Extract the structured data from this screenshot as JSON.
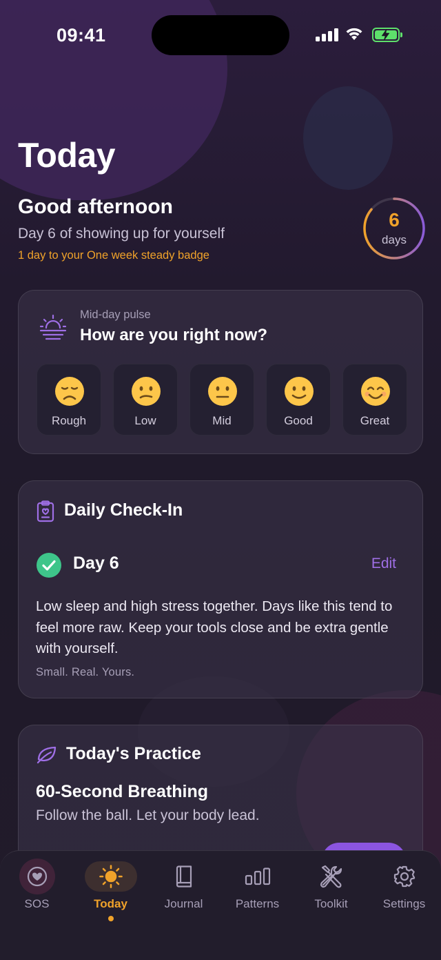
{
  "status_bar": {
    "time": "09:41"
  },
  "page": {
    "title": "Today"
  },
  "header": {
    "greeting": "Good afternoon",
    "subtitle": "Day 6 of showing up for yourself",
    "badge_progress": "1 day to your One week steady badge",
    "streak": {
      "value": "6",
      "unit": "days",
      "progress_fraction": 0.86
    }
  },
  "pulse_card": {
    "eyebrow": "Mid-day pulse",
    "question": "How are you right now?",
    "moods": [
      {
        "label": "Rough",
        "icon": "disappointed-face-icon"
      },
      {
        "label": "Low",
        "icon": "confused-face-icon"
      },
      {
        "label": "Mid",
        "icon": "neutral-face-icon"
      },
      {
        "label": "Good",
        "icon": "slight-smile-face-icon"
      },
      {
        "label": "Great",
        "icon": "smiling-face-icon"
      }
    ]
  },
  "checkin_card": {
    "title": "Daily Check-In",
    "day_label": "Day 6",
    "edit_label": "Edit",
    "summary": "Low sleep and high stress together. Days like this tend to feel more raw. Keep your tools close and be extra gentle with yourself.",
    "footnote": "Small. Real. Yours."
  },
  "practice_card": {
    "title": "Today's Practice",
    "name": "60-Second Breathing",
    "description": "Follow the ball. Let your body lead."
  },
  "tab_bar": {
    "active": "Today",
    "tabs": [
      {
        "label": "SOS",
        "icon": "heart-icon"
      },
      {
        "label": "Today",
        "icon": "sun-icon"
      },
      {
        "label": "Journal",
        "icon": "book-icon"
      },
      {
        "label": "Patterns",
        "icon": "bar-chart-icon"
      },
      {
        "label": "Toolkit",
        "icon": "tools-icon"
      },
      {
        "label": "Settings",
        "icon": "gear-icon"
      }
    ]
  },
  "colors": {
    "accent_orange": "#f0a22a",
    "accent_purple": "#9f6fe6",
    "check_green": "#3ec58a",
    "battery_green": "#5ee06b"
  }
}
